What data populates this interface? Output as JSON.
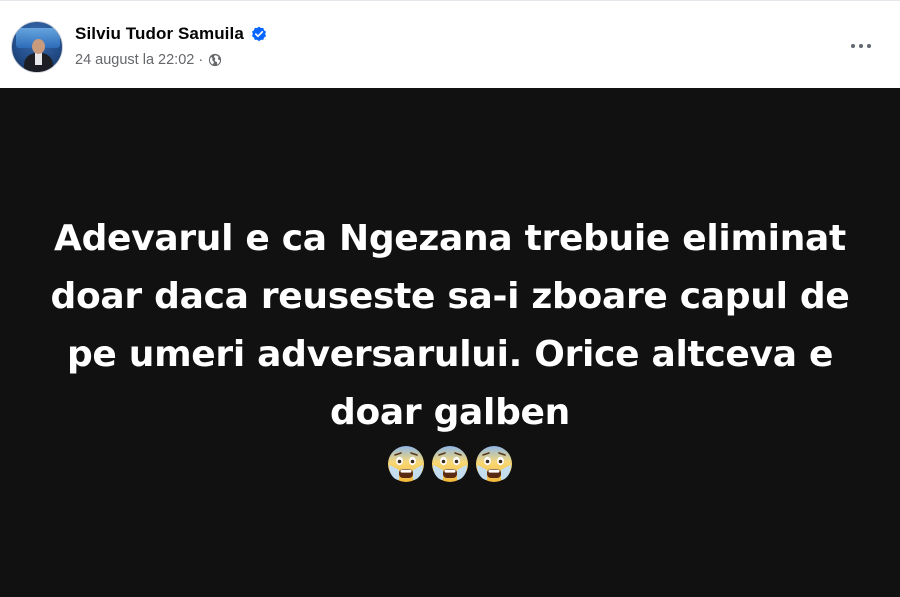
{
  "author": {
    "name": "Silviu Tudor Samuila",
    "verified": true,
    "avatar_icon": "profile-photo"
  },
  "meta": {
    "timestamp": "24 august la 22:02",
    "separator": "·",
    "audience_icon": "globe-icon"
  },
  "menu": {
    "icon": "more-horizontal-icon"
  },
  "post": {
    "background_color": "#111111",
    "text_color": "#ffffff",
    "text": "Adevarul e ca Ngezana trebuie eliminat doar daca reuseste sa-i zboare capul de pe umeri adversarului. Orice altceva e doar galben",
    "emojis": [
      "😨",
      "😨",
      "😨"
    ],
    "emoji_icon": "fearful-face-icon"
  },
  "colors": {
    "verified_blue": "#0866ff",
    "meta_gray": "#65676b"
  }
}
